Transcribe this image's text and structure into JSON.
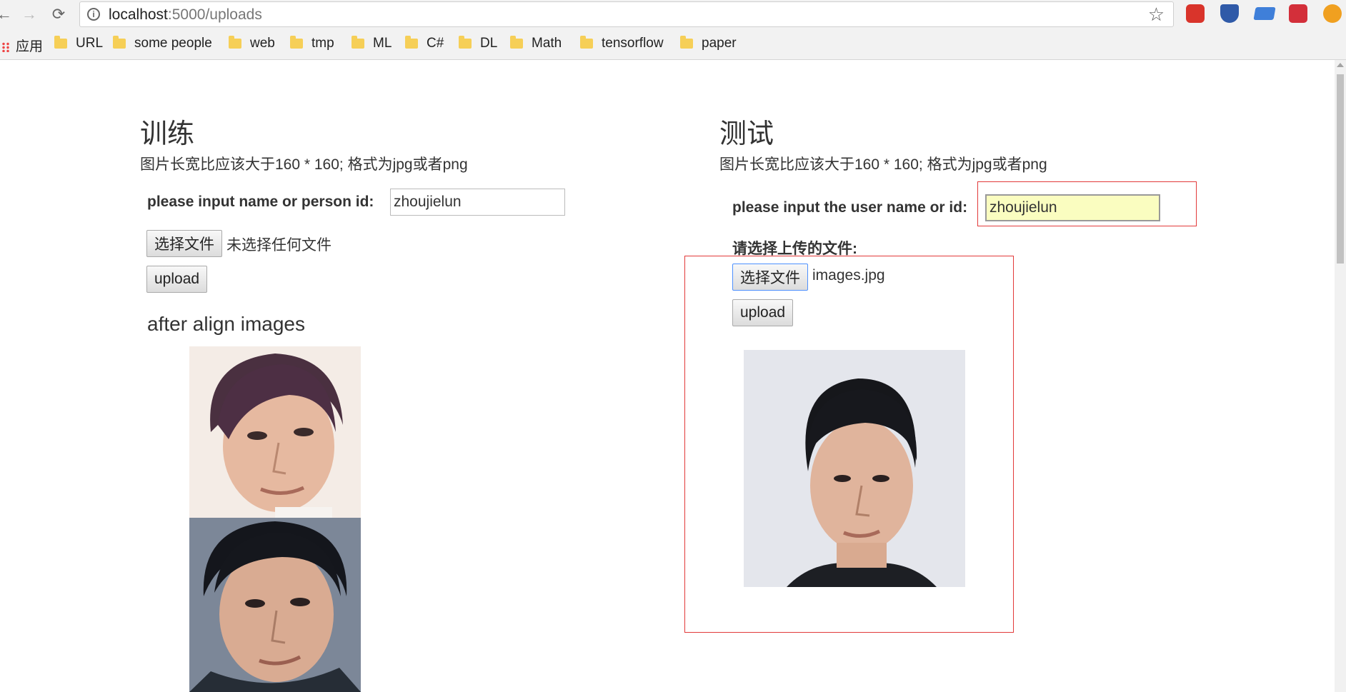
{
  "browser": {
    "url_host": "localhost",
    "url_rest": ":5000/uploads",
    "bookmarks": [
      {
        "label": "应用",
        "type": "apps"
      },
      {
        "label": "URL",
        "type": "folder"
      },
      {
        "label": "some people",
        "type": "folder"
      },
      {
        "label": "web",
        "type": "folder"
      },
      {
        "label": "tmp",
        "type": "folder"
      },
      {
        "label": "ML",
        "type": "folder"
      },
      {
        "label": "C#",
        "type": "folder"
      },
      {
        "label": "DL",
        "type": "folder"
      },
      {
        "label": "Math",
        "type": "folder"
      },
      {
        "label": "tensorflow",
        "type": "folder"
      },
      {
        "label": "paper",
        "type": "folder"
      }
    ],
    "extension_icons": [
      "adblock-icon",
      "shield-icon",
      "graduation-cap-icon",
      "fast-forward-icon",
      "alert-icon"
    ]
  },
  "train": {
    "title": "训练",
    "hint": "图片长宽比应该大于160 * 160; 格式为jpg或者png",
    "name_label": "please input name or person id:",
    "name_value": "zhoujielun",
    "choose_file_label": "选择文件",
    "file_status": "未选择任何文件",
    "upload_label": "upload",
    "aligned_heading": "after align images"
  },
  "test": {
    "title": "测试",
    "hint": "图片长宽比应该大于160 * 160; 格式为jpg或者png",
    "name_label": "please input the user name or id:",
    "name_value": "zhoujielun",
    "file_prompt": "请选择上传的文件:",
    "choose_file_label": "选择文件",
    "file_status": "images.jpg",
    "upload_label": "upload"
  },
  "colors": {
    "highlight_box": "#e23a3a",
    "autofill_bg": "#fafdc0"
  }
}
